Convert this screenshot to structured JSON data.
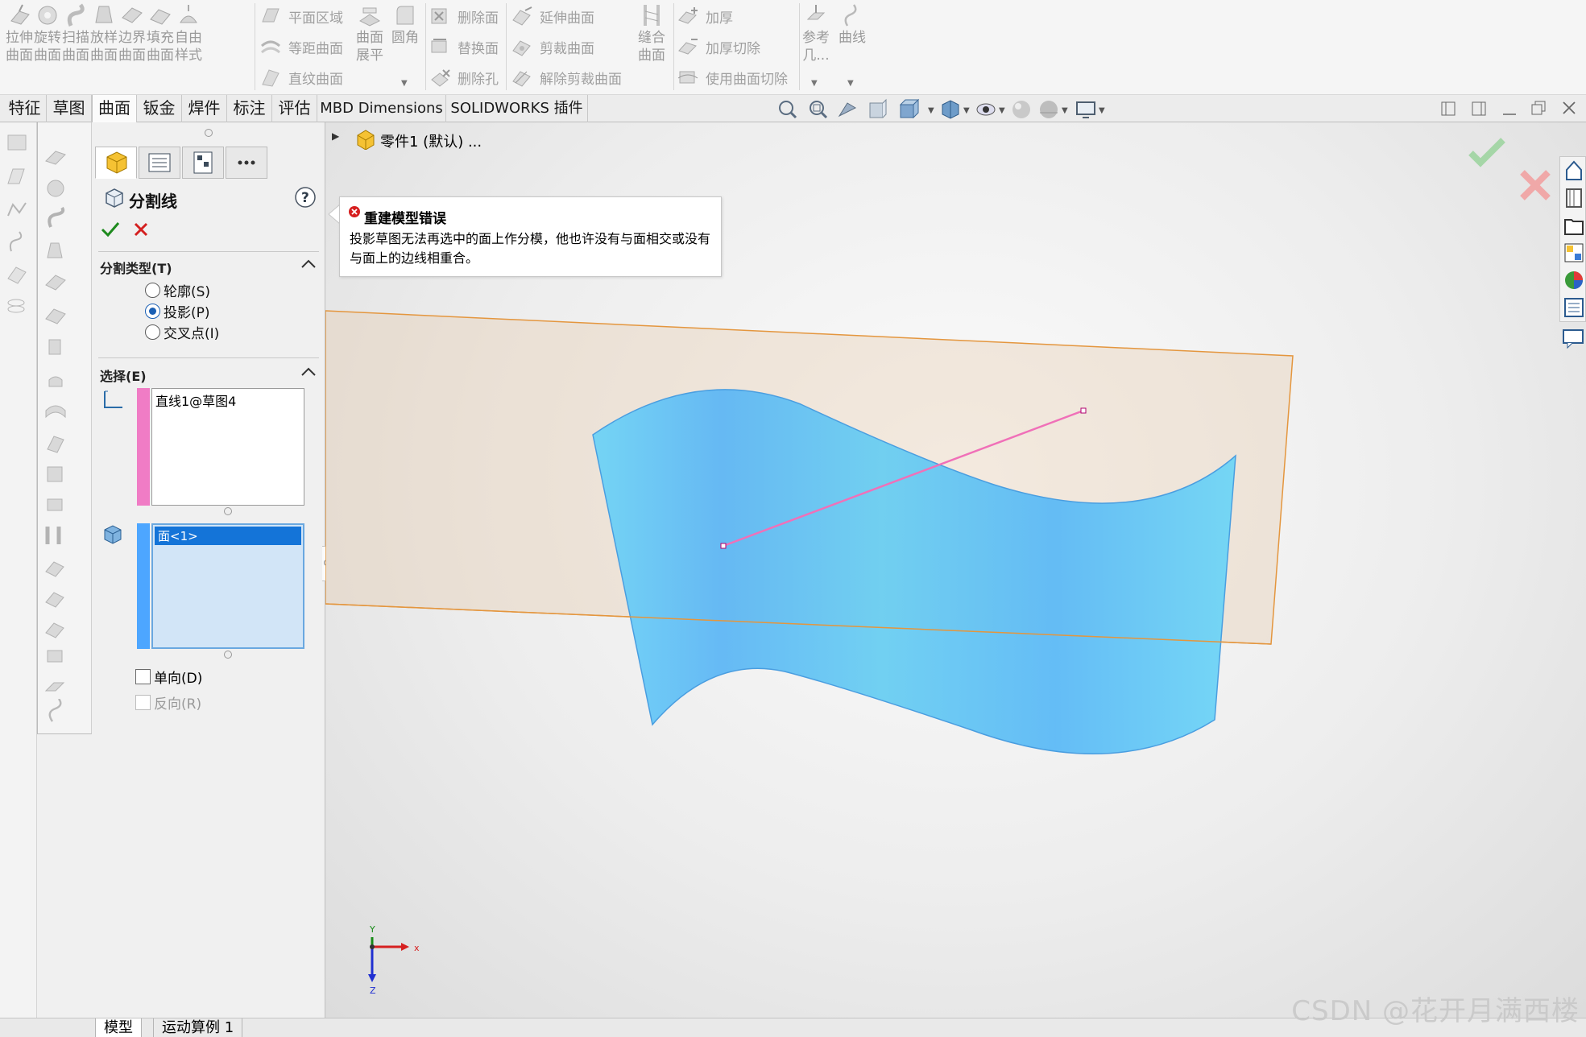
{
  "ribbon": {
    "big_buttons": [
      {
        "label": "拉伸\n曲面",
        "icon": "extrude-surface-icon"
      },
      {
        "label": "旋转\n曲面",
        "icon": "revolve-surface-icon"
      },
      {
        "label": "扫描\n曲面",
        "icon": "sweep-surface-icon"
      },
      {
        "label": "放样\n曲面",
        "icon": "loft-surface-icon"
      },
      {
        "label": "边界\n曲面",
        "icon": "boundary-surface-icon"
      },
      {
        "label": "填充\n曲面",
        "icon": "fill-surface-icon"
      },
      {
        "label": "自由\n样式",
        "icon": "freeform-icon"
      }
    ],
    "group1": [
      "平面区域",
      "等距曲面",
      "直纹曲面"
    ],
    "flatten": "曲面\n展平",
    "fillet": "圆角",
    "group2": [
      "删除面",
      "替换面",
      "删除孔"
    ],
    "group3": [
      "延伸曲面",
      "剪裁曲面",
      "解除剪裁曲面"
    ],
    "knit": "缝合\n曲面",
    "group4": [
      "加厚",
      "加厚切除",
      "使用曲面切除"
    ],
    "reference": "参考\n几...",
    "curves": "曲线"
  },
  "tabs": [
    "特征",
    "草图",
    "曲面",
    "钣金",
    "焊件",
    "标注",
    "评估",
    "MBD Dimensions",
    "SOLIDWORKS 插件"
  ],
  "active_tab": "曲面",
  "pm": {
    "title": "分割线",
    "type_section": "分割类型(T)",
    "type_options": [
      {
        "label": "轮廓(S)",
        "checked": false
      },
      {
        "label": "投影(P)",
        "checked": true
      },
      {
        "label": "交叉点(I)",
        "checked": false
      }
    ],
    "select_section": "选择(E)",
    "sketch_items": [
      "直线1@草图4"
    ],
    "face_items": [
      "面<1>"
    ],
    "single_direction": "单向(D)",
    "reverse": "反向(R)"
  },
  "tree": {
    "root": "零件1 (默认) ..."
  },
  "error": {
    "title": "重建模型错误",
    "message": "投影草图无法再选中的面上作分模，他也许没有与面相交或没有与面上的边线相重合。"
  },
  "axes": {
    "x": "x",
    "y": "Y",
    "z": "Z"
  },
  "bottom_tabs": [
    "模型",
    "运动算例 1"
  ],
  "watermark": "CSDN @花开月满西楼",
  "colors": {
    "accent": "#1a5fb4",
    "surface": "#5cc4f5",
    "plane": "#e89a3c",
    "sketch_line": "#f070b8"
  }
}
